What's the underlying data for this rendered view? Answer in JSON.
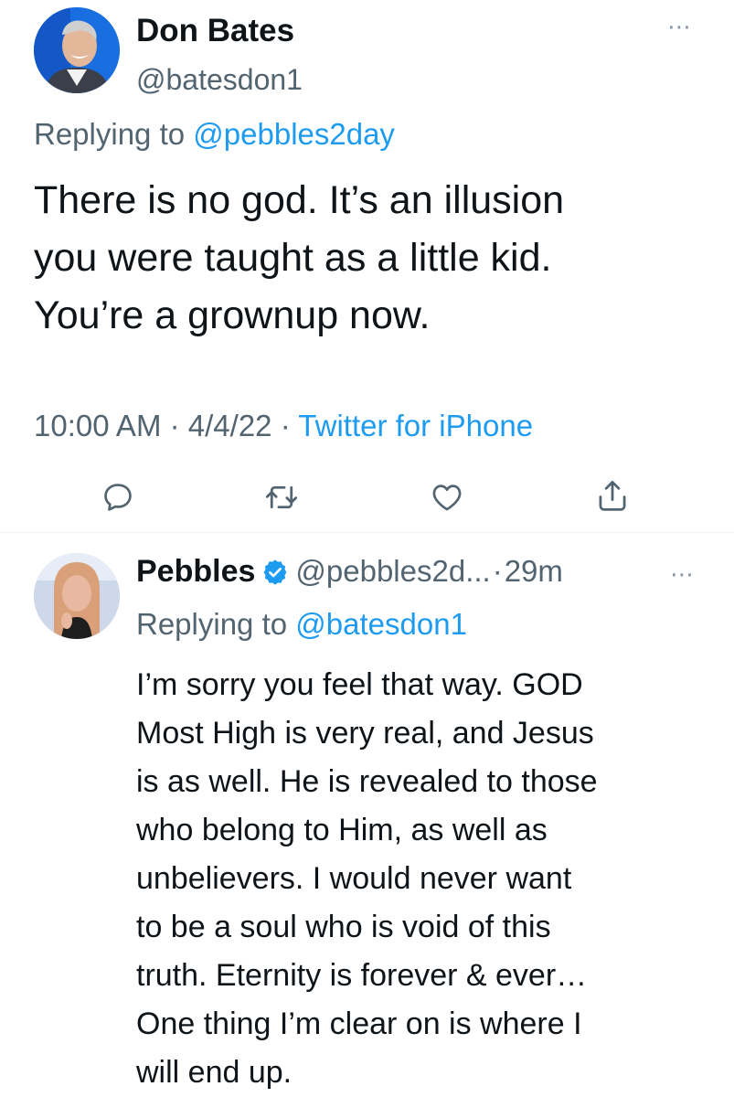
{
  "main_tweet": {
    "author_name": "Don Bates",
    "author_handle": "@batesdon1",
    "more_icon": "⋯",
    "replying_prefix": "Replying to",
    "replying_to": "@pebbles2day",
    "text": "There is no god. It’s an illusion\nyou were taught as a little kid.\nYou’re a grownup now.",
    "time": "10:00 AM",
    "sep1": "·",
    "date": "4/4/22",
    "sep2": "·",
    "source": "Twitter for iPhone",
    "actions": [
      "reply-icon",
      "retweet-icon",
      "like-icon",
      "share-icon"
    ]
  },
  "reply_tweet": {
    "author_name": "Pebbles",
    "verified_icon": "verified-badge-icon",
    "author_handle": "@pebbles2d...",
    "sep": "·",
    "age": "29m",
    "more_icon": "⋯",
    "replying_prefix": "Replying to",
    "replying_to": "@batesdon1",
    "text": "I’m sorry you feel that way. GOD\nMost High is very real, and Jesus\nis as well. He is revealed to those\nwho belong to Him, as well as\nunbelievers. I would never want\nto be a soul who is void of this\ntruth. Eternity is forever & ever…\nOne thing I’m clear on is where I\nwill end up."
  },
  "colors": {
    "accent": "#1d9bf0",
    "text": "#0f1419",
    "secondary": "#536471",
    "divider": "#eff3f4"
  }
}
